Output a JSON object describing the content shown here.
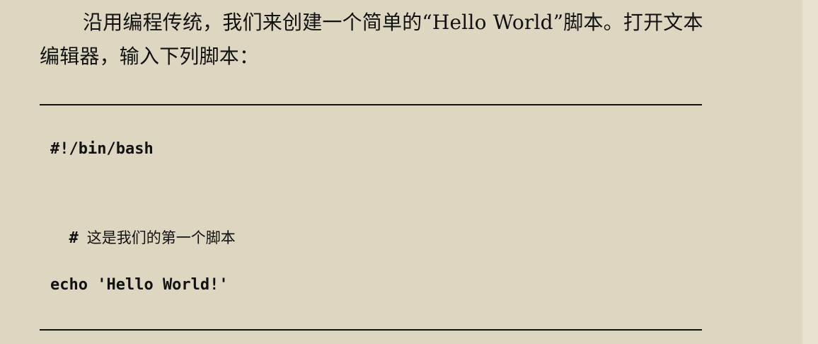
{
  "intro_text": "沿用编程传统，我们来创建一个简单的“Hello World”脚本。打开文本编辑器，输入下列脚本：",
  "code": {
    "line1": "#!/bin/bash",
    "line2_hash": "#",
    "line2_comment": "这是我们的第一个脚本",
    "line3": "echo 'Hello World!'"
  }
}
